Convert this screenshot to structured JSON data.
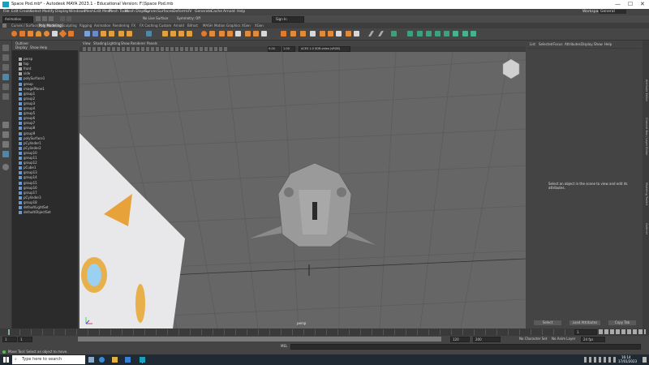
{
  "window": {
    "title": "Space Pod.mb* - Autodesk MAYA 2023.1 - Educational Version: F:\\Space Pod.mb",
    "controls": [
      "—",
      "☐",
      "✕"
    ]
  },
  "menubar": [
    "File",
    "Edit",
    "Create",
    "Select",
    "Modify",
    "Display",
    "Windows",
    "Mesh",
    "Edit Mesh",
    "Mesh Tools",
    "Mesh Display",
    "Curves",
    "Surfaces",
    "Deform",
    "UV",
    "Generate",
    "Cache",
    "Arnold",
    "Help"
  ],
  "workspace": {
    "label": "Workspace:",
    "value": "General"
  },
  "statusline": {
    "menuset": "Animation",
    "live_surface": "No Live Surface",
    "symmetry": "Symmetry: Off",
    "signin": "Sign In"
  },
  "shelf_tabs": [
    {
      "label": "Curves / Surfaces"
    },
    {
      "label": "Poly Modeling",
      "active": true
    },
    {
      "label": "Sculpting"
    },
    {
      "label": "Rigging"
    },
    {
      "label": "Animation"
    },
    {
      "label": "Rendering"
    },
    {
      "label": "FX"
    },
    {
      "label": "FX Caching"
    },
    {
      "label": "Custom"
    },
    {
      "label": "Arnold"
    },
    {
      "label": "Bifrost"
    },
    {
      "label": "MASH"
    },
    {
      "label": "Motion Graphics"
    },
    {
      "label": "XGen"
    },
    {
      "label": "XGen"
    }
  ],
  "outliner": {
    "menus": [
      "Outliner",
      "Display",
      "Show",
      "Help"
    ],
    "items": [
      "persp",
      "top",
      "front",
      "side",
      "polySurface1",
      "group",
      "imagePlane1",
      "group1",
      "group2",
      "group3",
      "group4",
      "group5",
      "group6",
      "group7",
      "group8",
      "group9",
      "polySurface1",
      "pCylinder1",
      "pCylinder2",
      "group10",
      "group11",
      "group12",
      "pCube1",
      "group13",
      "group14",
      "group15",
      "group16",
      "group17",
      "pCylinder3",
      "group18",
      "defaultLightSet",
      "defaultObjectSet"
    ]
  },
  "viewport": {
    "menus": [
      "View",
      "Shading",
      "Lighting",
      "Show",
      "Renderer",
      "Panels"
    ],
    "field_value_a": "0.00",
    "field_value_b": "1.00",
    "color_space": "ACES 1.0 SDR-video (sRGB)",
    "camera_label": "persp"
  },
  "attribute_editor": {
    "menus": [
      "List",
      "Selected",
      "Focus",
      "Attributes",
      "Display",
      "Show",
      "Help"
    ],
    "empty_message": "Select an object in the scene to view and edit its attributes.",
    "buttons": [
      "Select",
      "Load Attributes",
      "Copy Tab"
    ],
    "side_tabs": [
      "Attribute Editor",
      "Channel Box / Layer Editor",
      "Modeling Toolkit",
      "Outliner"
    ]
  },
  "timeline": {
    "start": "1",
    "end": "120",
    "range_start": "1",
    "range_inner_start": "1",
    "range_inner_end": "120",
    "range_end": "200",
    "current": "1",
    "fps": "24 fps",
    "character_set": "No Character Set",
    "anim_layer": "No Anim Layer"
  },
  "command_line": {
    "label": "MEL"
  },
  "help_line": {
    "text": "Move Tool: Select an object to move."
  },
  "taskbar": {
    "search_placeholder": "Type here to search",
    "time": "16:14",
    "date": "17/01/2023"
  },
  "colors": {
    "accent_blue": "#5285a6",
    "poly_orange": "#e8a23a",
    "viewport_bg": "#666666",
    "grid": "#5a5a5a"
  }
}
